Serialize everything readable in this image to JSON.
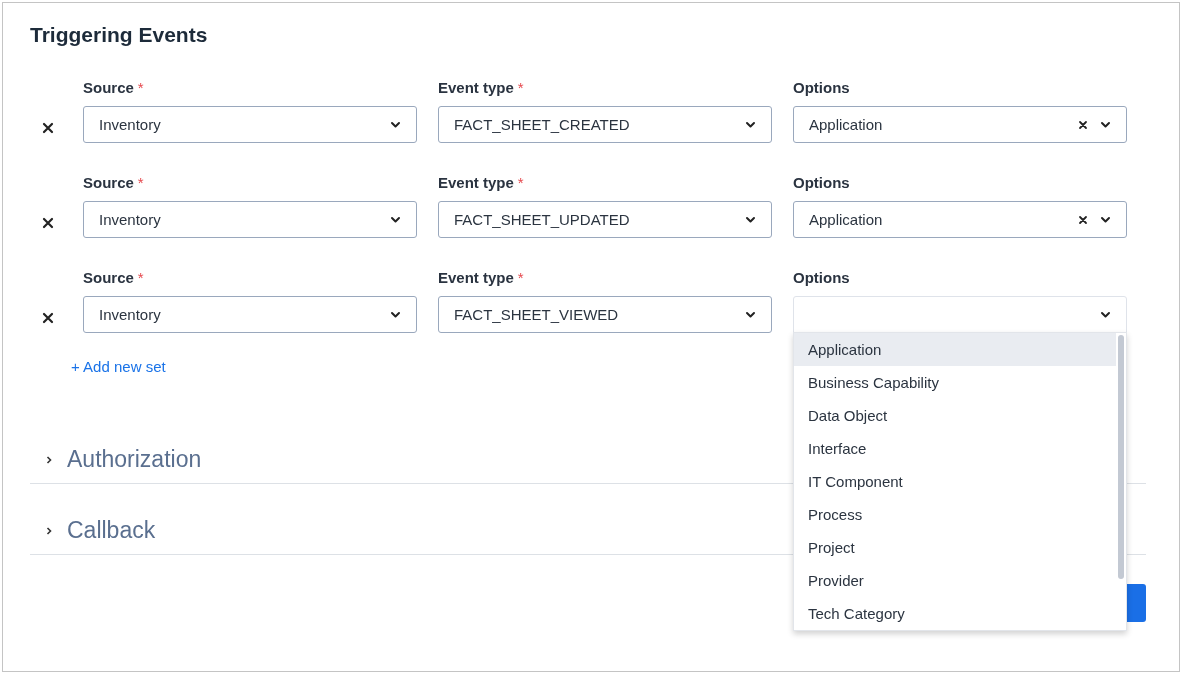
{
  "section_title": "Triggering Events",
  "event_sets": [
    {
      "source": {
        "label": "Source",
        "required_mark": "*",
        "value": "Inventory"
      },
      "event_type": {
        "label": "Event type",
        "required_mark": "*",
        "value": "FACT_SHEET_CREATED"
      },
      "options": {
        "label": "Options",
        "value": "Application",
        "open": false
      }
    },
    {
      "source": {
        "label": "Source",
        "required_mark": "*",
        "value": "Inventory"
      },
      "event_type": {
        "label": "Event type",
        "required_mark": "*",
        "value": "FACT_SHEET_UPDATED"
      },
      "options": {
        "label": "Options",
        "value": "Application",
        "open": false
      }
    },
    {
      "source": {
        "label": "Source",
        "required_mark": "*",
        "value": "Inventory"
      },
      "event_type": {
        "label": "Event type",
        "required_mark": "*",
        "value": "FACT_SHEET_VIEWED"
      },
      "options": {
        "label": "Options",
        "open": true
      }
    }
  ],
  "add_link": "+ Add new set",
  "collapsibles": [
    {
      "title": "Authorization",
      "expanded": false
    },
    {
      "title": "Callback",
      "expanded": false
    }
  ],
  "dropdown_items": [
    {
      "label": "Application",
      "selected": true
    },
    {
      "label": "Business Capability",
      "selected": false
    },
    {
      "label": "Data Object",
      "selected": false
    },
    {
      "label": "Interface",
      "selected": false
    },
    {
      "label": "IT Component",
      "selected": false
    },
    {
      "label": "Process",
      "selected": false
    },
    {
      "label": "Project",
      "selected": false
    },
    {
      "label": "Provider",
      "selected": false
    },
    {
      "label": "Tech Category",
      "selected": false
    }
  ]
}
